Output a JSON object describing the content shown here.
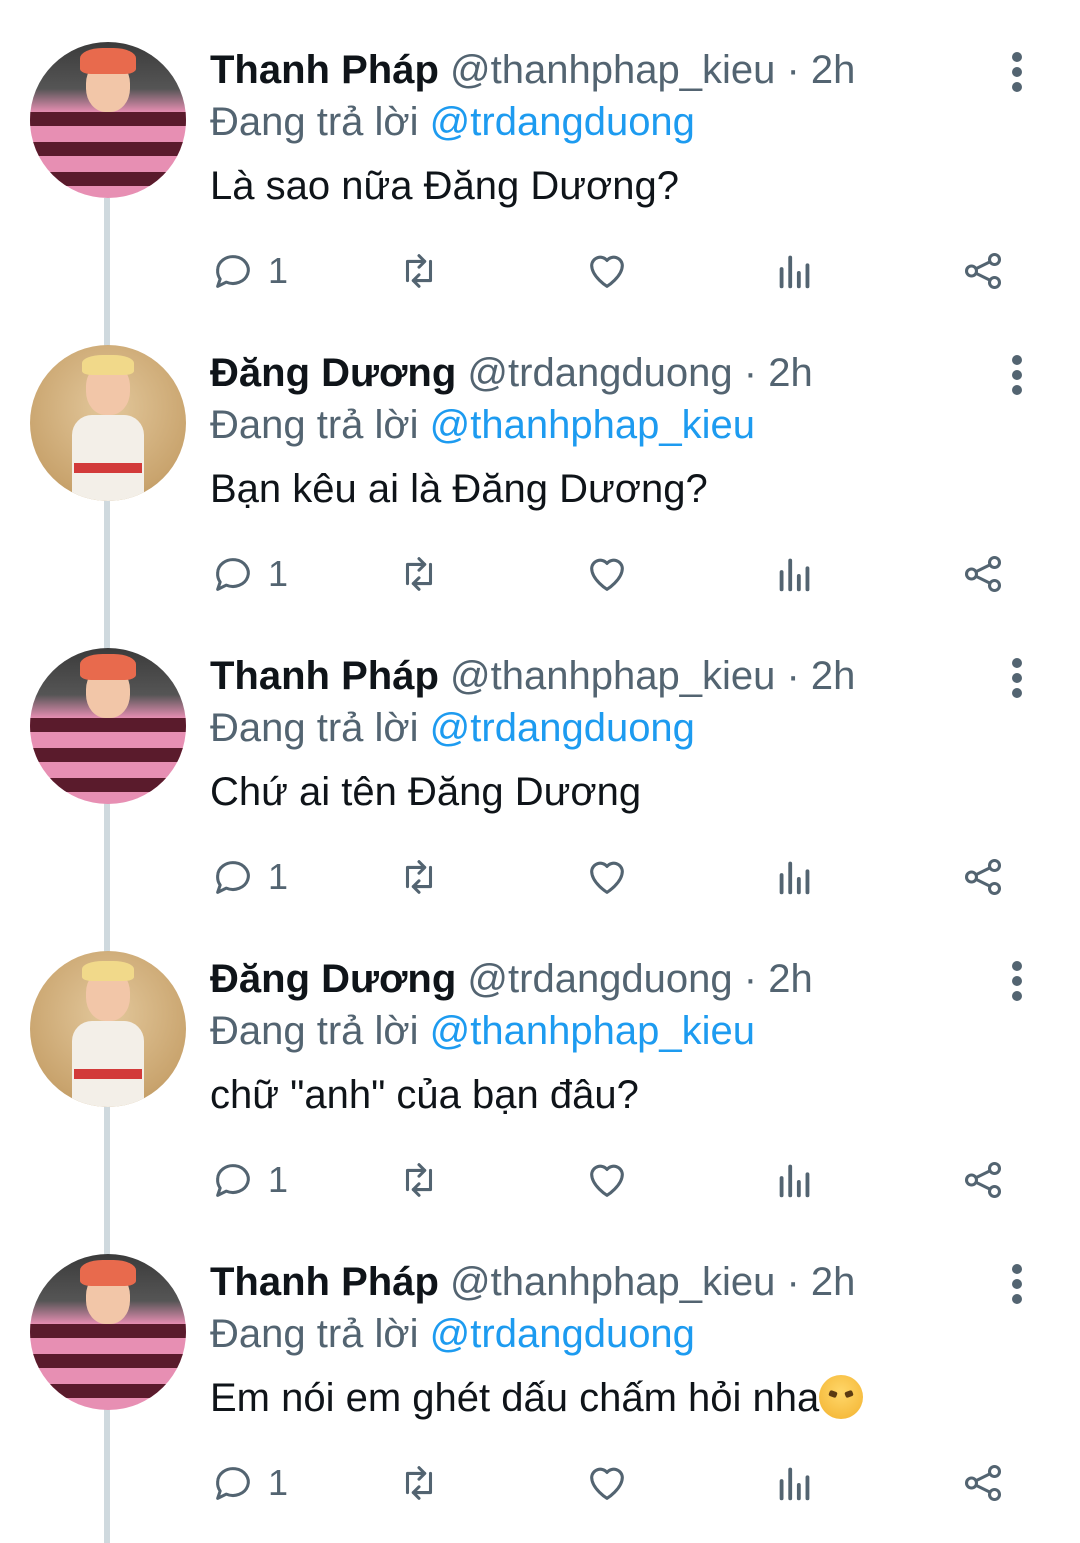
{
  "colors": {
    "name": "#0f1419",
    "secondary": "#536471",
    "mention": "#1d9bf0",
    "thread_line": "#cfd9de"
  },
  "tweets": [
    {
      "name": "Thanh Pháp",
      "handle": "@thanhphap_kieu",
      "dot": "·",
      "time": "2h",
      "reply_prefix": "Đang trả lời",
      "reply_to": "@trdangduong",
      "text": "Là sao nữa Đăng Dương?",
      "reply_count": "1",
      "avatar": "pink"
    },
    {
      "name": "Đăng Dương",
      "handle": "@trdangduong",
      "dot": "·",
      "time": "2h",
      "reply_prefix": "Đang trả lời",
      "reply_to": "@thanhphap_kieu",
      "text": "Bạn kêu ai là Đăng Dương?",
      "reply_count": "1",
      "avatar": "beige"
    },
    {
      "name": "Thanh Pháp",
      "handle": "@thanhphap_kieu",
      "dot": "·",
      "time": "2h",
      "reply_prefix": "Đang trả lời",
      "reply_to": "@trdangduong",
      "text": "Chứ ai tên Đăng Dương",
      "reply_count": "1",
      "avatar": "pink"
    },
    {
      "name": "Đăng Dương",
      "handle": "@trdangduong",
      "dot": "·",
      "time": "2h",
      "reply_prefix": "Đang trả lời",
      "reply_to": "@thanhphap_kieu",
      "text": "chữ \"anh\" của bạn đâu?",
      "reply_count": "1",
      "avatar": "beige"
    },
    {
      "name": "Thanh Pháp",
      "handle": "@thanhphap_kieu",
      "dot": "·",
      "time": "2h",
      "reply_prefix": "Đang trả lời",
      "reply_to": "@trdangduong",
      "text": "Em nói em ghét dấu chấm hỏi nha",
      "reply_count": "1",
      "avatar": "pink",
      "emoji": "angry-face-emoji"
    }
  ],
  "icons": {
    "reply": "reply-bubble-icon",
    "retweet": "retweet-icon",
    "like": "heart-icon",
    "views": "analytics-icon",
    "share": "share-icon",
    "more": "more-vertical-icon"
  }
}
